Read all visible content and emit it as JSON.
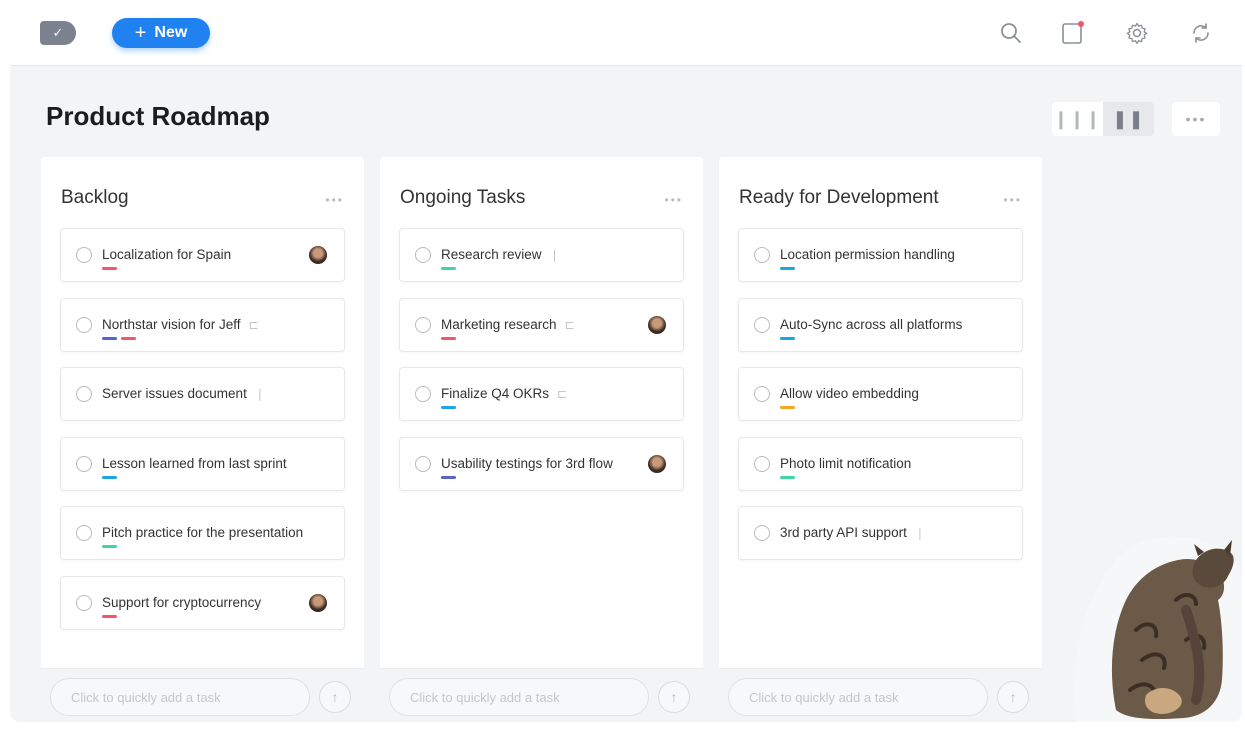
{
  "header": {
    "new_button_label": "New",
    "icons": [
      "search-icon",
      "notification-icon",
      "gear-icon",
      "sync-icon"
    ]
  },
  "page": {
    "title": "Product Roadmap"
  },
  "colors": {
    "accent": "#1f82f0",
    "tag_red": "#f0566e",
    "tag_blue": "#1fa3e8",
    "tag_indigo": "#5b63c9",
    "tag_green": "#3ed6a4",
    "tag_orange": "#f5a623",
    "notification_dot": "#f0566e"
  },
  "columns": [
    {
      "title": "Backlog",
      "quick_add_placeholder": "Click to quickly add a task",
      "cards": [
        {
          "label": "Localization for Spain",
          "tags": [
            "#f0566e"
          ],
          "avatar": true,
          "meta": ""
        },
        {
          "label": "Northstar vision for Jeff",
          "tags": [
            "#5b63c9",
            "#f0566e"
          ],
          "avatar": false,
          "meta": "subtasks-icon"
        },
        {
          "label": "Server issues document",
          "tags": [],
          "avatar": false,
          "meta": "attachment-icon"
        },
        {
          "label": "Lesson learned from last sprint",
          "tags": [
            "#1fa3e8"
          ],
          "avatar": false,
          "meta": ""
        },
        {
          "label": "Pitch practice for the presentation",
          "tags": [
            "#3ed6a4"
          ],
          "avatar": false,
          "meta": ""
        },
        {
          "label": "Support for cryptocurrency",
          "tags": [
            "#f0566e"
          ],
          "avatar": true,
          "meta": ""
        }
      ]
    },
    {
      "title": "Ongoing Tasks",
      "quick_add_placeholder": "Click to quickly add a task",
      "cards": [
        {
          "label": "Research review",
          "tags": [
            "#3ed6a4"
          ],
          "avatar": false,
          "meta": "attachment-icon"
        },
        {
          "label": "Marketing research",
          "tags": [
            "#f0566e"
          ],
          "avatar": true,
          "meta": "subtasks-icon"
        },
        {
          "label": "Finalize Q4 OKRs",
          "tags": [
            "#1fa3e8"
          ],
          "avatar": false,
          "meta": "subtasks-icon"
        },
        {
          "label": "Usability testings for 3rd flow",
          "tags": [
            "#5b63c9"
          ],
          "avatar": true,
          "meta": ""
        }
      ]
    },
    {
      "title": "Ready for Development",
      "quick_add_placeholder": "Click to quickly add a task",
      "cards": [
        {
          "label": "Location permission handling",
          "tags": [
            "#1fa3e8"
          ],
          "avatar": false,
          "meta": ""
        },
        {
          "label": "Auto-Sync across all platforms",
          "tags": [
            "#1fa3e8"
          ],
          "avatar": false,
          "meta": ""
        },
        {
          "label": "Allow video embedding",
          "tags": [
            "#f5a623"
          ],
          "avatar": false,
          "meta": ""
        },
        {
          "label": "Photo limit notification",
          "tags": [
            "#3ed6a4"
          ],
          "avatar": false,
          "meta": ""
        },
        {
          "label": "3rd party API support",
          "tags": [],
          "avatar": false,
          "meta": "attachment-icon"
        }
      ]
    }
  ]
}
